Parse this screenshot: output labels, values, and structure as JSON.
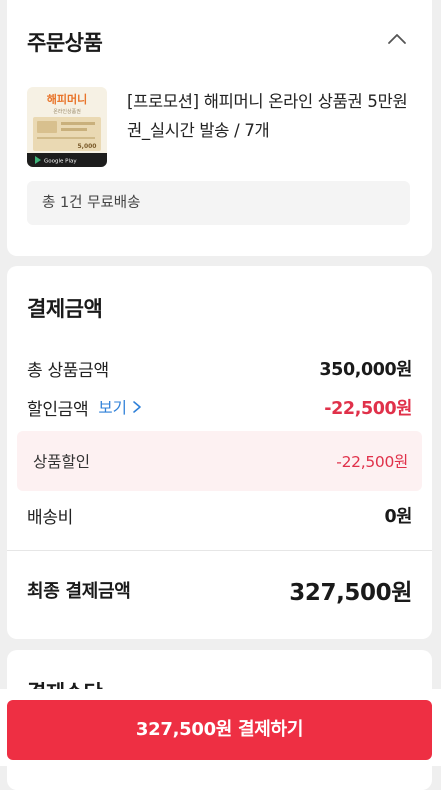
{
  "order": {
    "title": "주문상품",
    "product": {
      "thumb_brand": "해피머니",
      "thumb_subtitle": "온라인상품권",
      "thumb_amount": "5,000",
      "thumb_store": "Google Play",
      "name": "[프로모션] 해피머니 온라인 상품권 5만원권_실시간 발송 / 7개"
    },
    "shipping_summary": "총 1건 무료배송"
  },
  "payment": {
    "title": "결제금액",
    "total_product_label": "총 상품금액",
    "total_product_value": "350,000원",
    "discount_label": "할인금액",
    "discount_view_link": "보기",
    "discount_value": "-22,500원",
    "product_discount_label": "상품할인",
    "product_discount_value": "-22,500원",
    "shipping_label": "배송비",
    "shipping_value": "0원",
    "final_label": "최종 결제금액",
    "final_value": "327,500원"
  },
  "method": {
    "title": "결제수단"
  },
  "cta": {
    "pay_label": "327,500원 결제하기"
  },
  "colors": {
    "accent": "#ee2f43",
    "discount": "#e0314a",
    "link": "#2f80d8"
  }
}
